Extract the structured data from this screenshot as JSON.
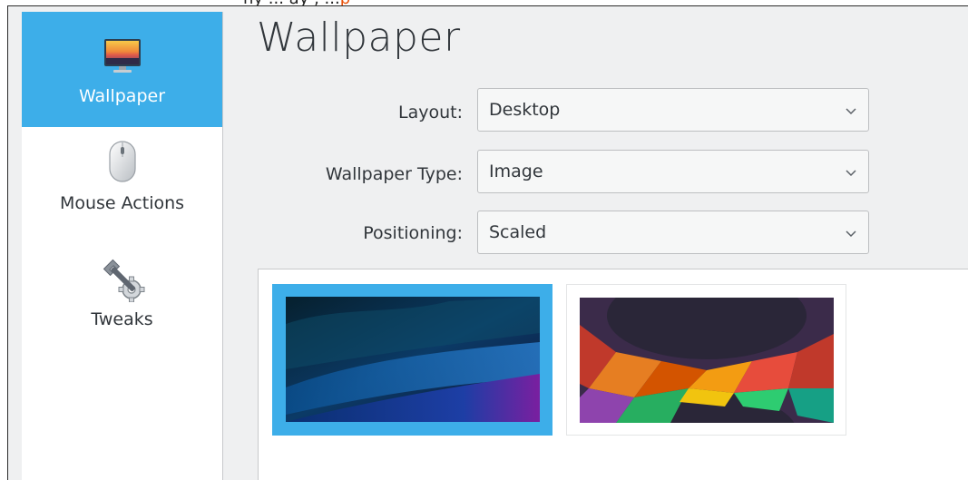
{
  "top_strip": {
    "text_a": "ny ... ay , ...",
    "text_b": "p"
  },
  "sidebar": {
    "items": [
      {
        "label": "Wallpaper",
        "icon": "monitor-wallpaper-icon",
        "selected": true
      },
      {
        "label": "Mouse Actions",
        "icon": "mouse-icon",
        "selected": false
      },
      {
        "label": "Tweaks",
        "icon": "wrench-gear-icon",
        "selected": false
      }
    ]
  },
  "main": {
    "title": "Wallpaper",
    "fields": {
      "layout": {
        "label": "Layout:",
        "value": "Desktop"
      },
      "wallpaper_type": {
        "label": "Wallpaper Type:",
        "value": "Image"
      },
      "positioning": {
        "label": "Positioning:",
        "value": "Scaled"
      }
    },
    "thumbnails": [
      {
        "name": "blue-waves",
        "selected": true
      },
      {
        "name": "colorful-polygons",
        "selected": false
      }
    ]
  },
  "colors": {
    "accent": "#3daee9",
    "window_bg": "#eff0f1",
    "text": "#31363b"
  }
}
